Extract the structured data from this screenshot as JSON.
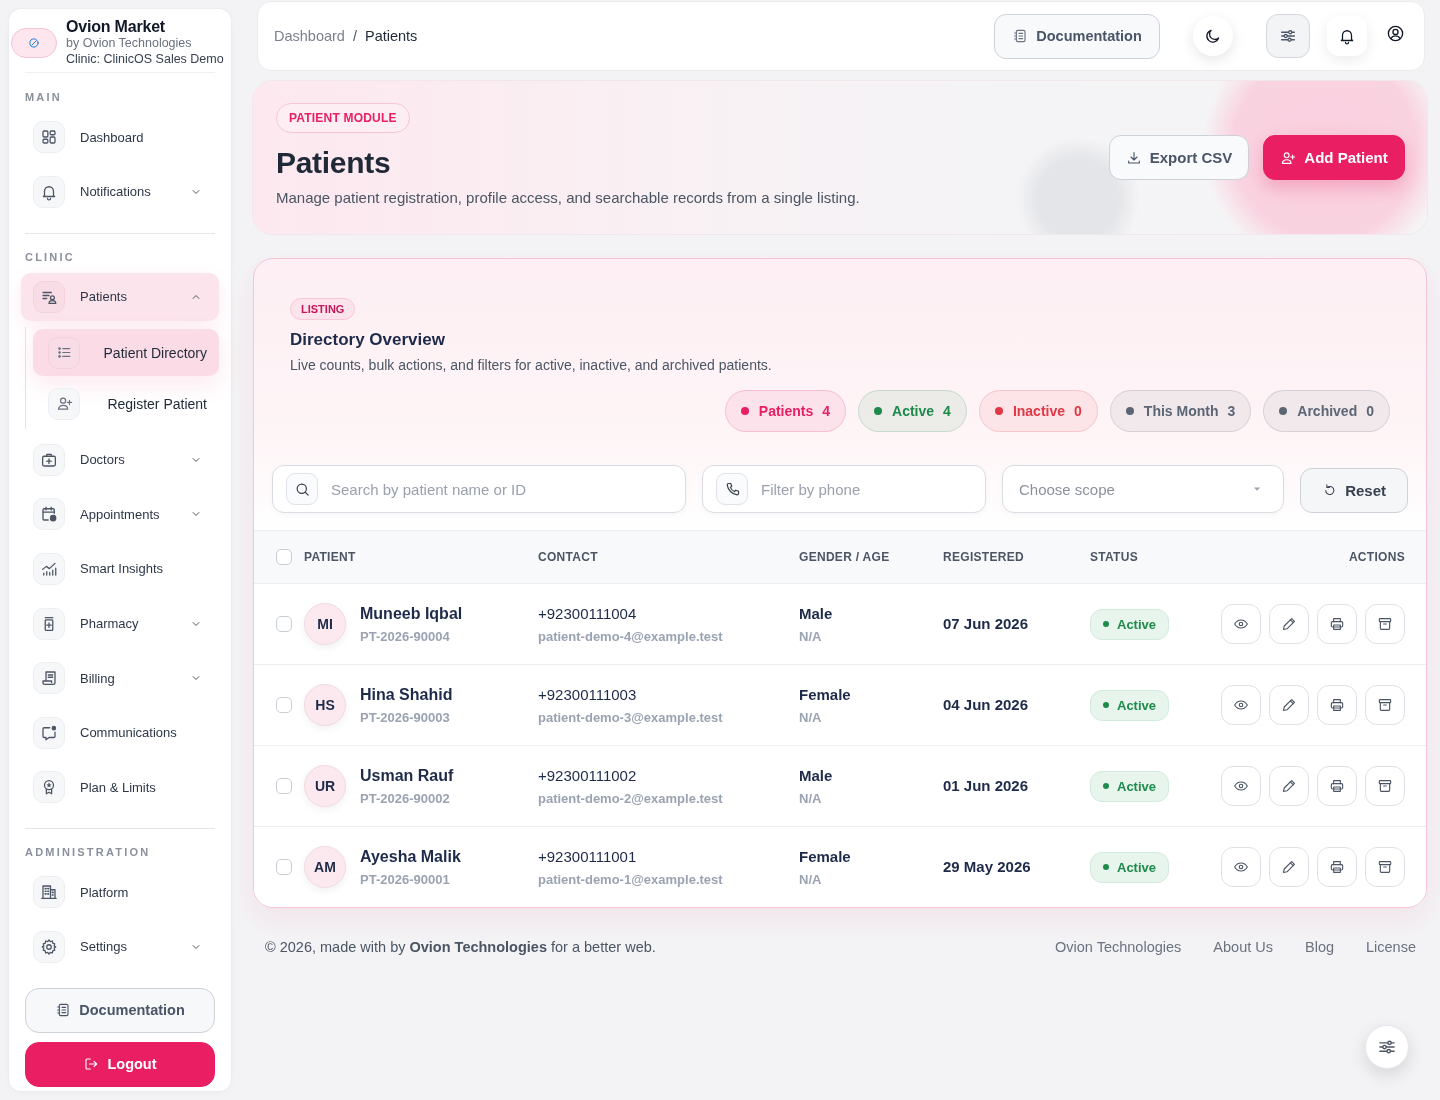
{
  "sidebar": {
    "brand": {
      "name": "Ovion Market",
      "byline": "by Ovion Technologies",
      "clinic": "Clinic: ClinicOS Sales Demo"
    },
    "sections": [
      {
        "heading": "MAIN",
        "items": [
          {
            "label": "Dashboard",
            "kind": "link",
            "selected": false
          },
          {
            "label": "Notifications",
            "kind": "menu",
            "expanded": false,
            "selected": false
          }
        ]
      },
      {
        "heading": "CLINIC",
        "items": [
          {
            "label": "Patients",
            "kind": "menu",
            "expanded": true,
            "selected": true,
            "children": [
              {
                "label": "Patient Directory",
                "selected": true
              },
              {
                "label": "Register Patient",
                "selected": false
              }
            ]
          },
          {
            "label": "Doctors",
            "kind": "menu",
            "expanded": false,
            "selected": false
          },
          {
            "label": "Appointments",
            "kind": "menu",
            "expanded": false,
            "selected": false
          },
          {
            "label": "Smart Insights",
            "kind": "link",
            "selected": false
          },
          {
            "label": "Pharmacy",
            "kind": "menu",
            "expanded": false,
            "selected": false
          },
          {
            "label": "Billing",
            "kind": "menu",
            "expanded": false,
            "selected": false
          },
          {
            "label": "Communications",
            "kind": "link",
            "selected": false
          },
          {
            "label": "Plan & Limits",
            "kind": "link",
            "selected": false
          }
        ]
      },
      {
        "heading": "ADMINISTRATION",
        "items": [
          {
            "label": "Platform",
            "kind": "link",
            "selected": false
          },
          {
            "label": "Settings",
            "kind": "menu",
            "expanded": false,
            "selected": false
          }
        ]
      }
    ],
    "buttons": [
      {
        "label": "Documentation",
        "kind": "secondary"
      },
      {
        "label": "Logout",
        "kind": "danger"
      }
    ]
  },
  "topbar": {
    "breadcrumb": {
      "separator": "/",
      "items": [
        {
          "label": "Dashboard",
          "selected": false
        },
        {
          "label": "Patients",
          "selected": true
        }
      ]
    },
    "documentation_button": "Documentation"
  },
  "header": {
    "badge": "PATIENT MODULE",
    "title": "Patients",
    "description": "Manage patient registration, profile access, and searchable records from a single listing.",
    "buttons": [
      {
        "label": "Export CSV",
        "kind": "secondary"
      },
      {
        "label": "Add Patient",
        "kind": "primary"
      }
    ]
  },
  "listing": {
    "badge": "LISTING",
    "title": "Directory Overview",
    "description": "Live counts, bulk actions, and filters for active, inactive, and archived patients.",
    "stats": [
      {
        "label": "Patients",
        "count": "4",
        "color": "#e91e63"
      },
      {
        "label": "Active",
        "count": "4",
        "color": "#1e8a4c"
      },
      {
        "label": "Inactive",
        "count": "0",
        "color": "#e23744"
      },
      {
        "label": "This Month",
        "count": "3",
        "color": "#5b6574"
      },
      {
        "label": "Archived",
        "count": "0",
        "color": "#5b6574"
      }
    ],
    "filters": {
      "search": {
        "placeholder": "Search by patient name or ID"
      },
      "phone": {
        "placeholder": "Filter by phone"
      },
      "scope": {
        "placeholder": "Choose scope"
      },
      "reset_button": "Reset"
    },
    "table": {
      "select_all": {
        "checked": false
      },
      "columns": [
        "PATIENT",
        "CONTACT",
        "GENDER / AGE",
        "REGISTERED",
        "STATUS",
        "ACTIONS"
      ],
      "rows": [
        {
          "checked": false,
          "initials": "MI",
          "name": "Muneeb Iqbal",
          "patient_id": "PT-2026-90004",
          "phone": "+92300111004",
          "email": "patient-demo-4@example.test",
          "gender": "Male",
          "age": "N/A",
          "registered": "07 Jun 2026",
          "status": "Active"
        },
        {
          "checked": false,
          "initials": "HS",
          "name": "Hina Shahid",
          "patient_id": "PT-2026-90003",
          "phone": "+92300111003",
          "email": "patient-demo-3@example.test",
          "gender": "Female",
          "age": "N/A",
          "registered": "04 Jun 2026",
          "status": "Active"
        },
        {
          "checked": false,
          "initials": "UR",
          "name": "Usman Rauf",
          "patient_id": "PT-2026-90002",
          "phone": "+92300111002",
          "email": "patient-demo-2@example.test",
          "gender": "Male",
          "age": "N/A",
          "registered": "01 Jun 2026",
          "status": "Active"
        },
        {
          "checked": false,
          "initials": "AM",
          "name": "Ayesha Malik",
          "patient_id": "PT-2026-90001",
          "phone": "+92300111001",
          "email": "patient-demo-1@example.test",
          "gender": "Female",
          "age": "N/A",
          "registered": "29 May 2026",
          "status": "Active"
        }
      ]
    }
  },
  "footer": {
    "credit": "© 2026, made with by **Ovion Technologies** for a better web.",
    "links": [
      "Ovion Technologies",
      "About Us",
      "Blog",
      "License"
    ]
  }
}
